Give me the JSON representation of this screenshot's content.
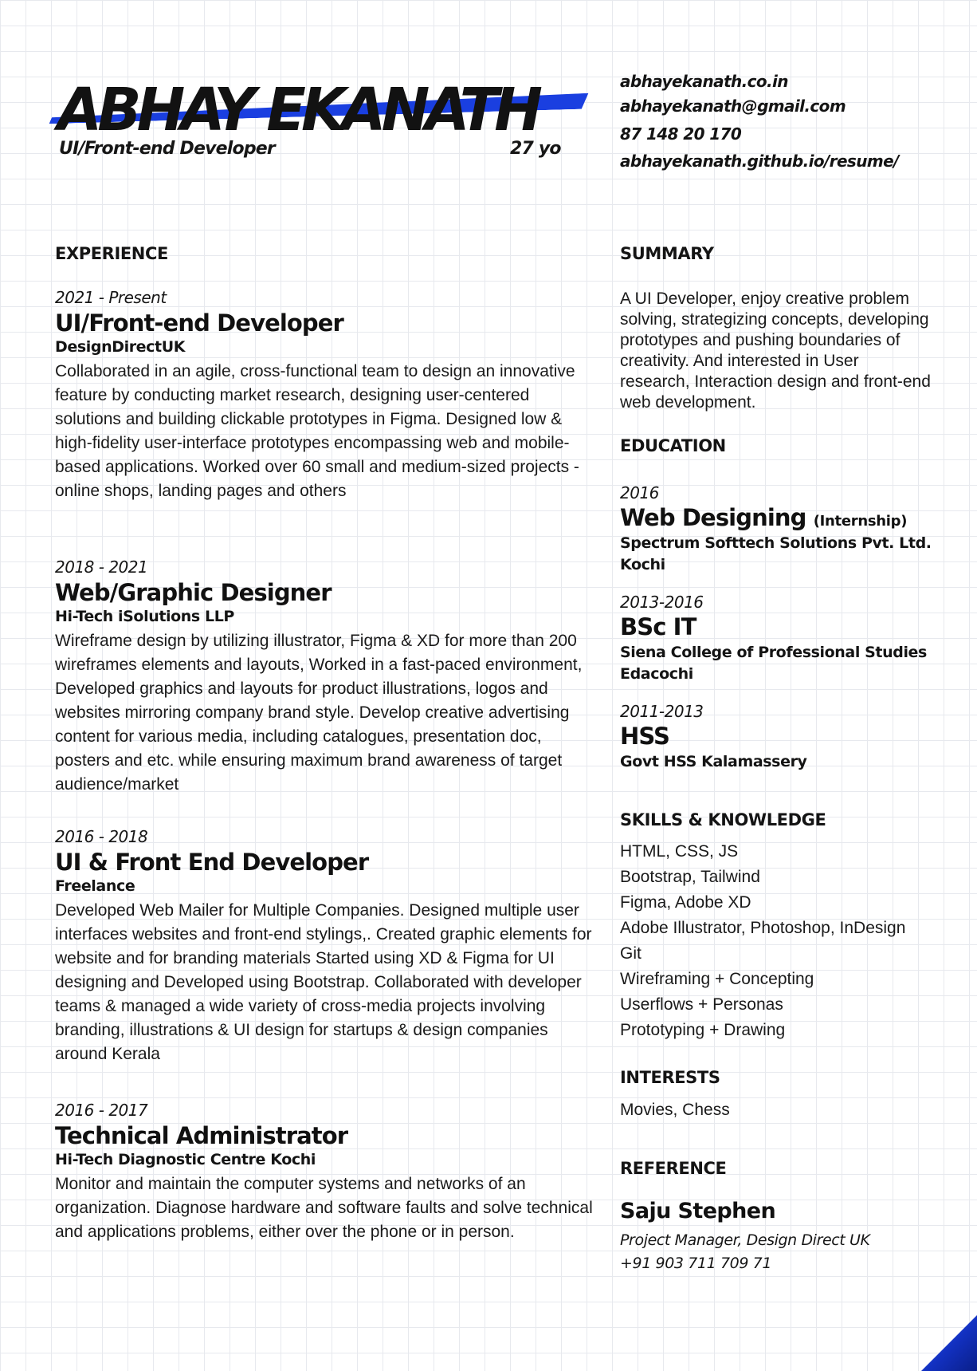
{
  "header": {
    "name": "ABHAY EKANATH",
    "role": "UI/Front-end Developer",
    "age": "27 yo",
    "accent_color": "#1a3fe0"
  },
  "contacts": {
    "website": "abhayekanath.co.in",
    "email": "abhayekanath@gmail.com",
    "phone": "87 148 20 170",
    "resume_url": "abhayekanath.github.io/resume/"
  },
  "experience": {
    "title": "EXPERIENCE",
    "items": [
      {
        "period": "2021 - Present",
        "title": "UI/Front-end Developer",
        "company": "DesignDirectUK",
        "desc": "Collaborated in an agile, cross-functional team to design an innovative feature by conducting market research, designing user-centered solutions and building clickable prototypes in Figma. Designed low & high-fidelity user-interface prototypes encompassing web and mobile-based applications. Worked over 60 small and medium-sized projects - online shops, landing pages and others"
      },
      {
        "period": "2018 - 2021",
        "title": "Web/Graphic Designer",
        "company": "Hi-Tech iSolutions LLP",
        "desc": "Wireframe design by utilizing illustrator, Figma & XD for more than 200 wireframes elements and layouts, Worked in a fast-paced environment, Developed graphics and layouts for product illustrations, logos and websites mirroring company brand style. Develop creative advertising content for various media, including catalogues, presentation doc, posters and etc. while ensuring maximum brand awareness of target audience/market"
      },
      {
        "period": "2016 - 2018",
        "title": "UI & Front End Developer",
        "company": "Freelance",
        "desc": "Developed Web Mailer for Multiple Companies. Designed multiple user interfaces websites and front-end stylings,. Created graphic elements for website and for branding materials Started using XD & Figma for UI designing and Developed using Bootstrap. Collaborated with developer teams & managed a wide variety of cross-media projects involving branding, illustrations & UI design for startups & design companies around Kerala"
      },
      {
        "period": "2016 - 2017",
        "title": "Technical Administrator",
        "company": "Hi-Tech Diagnostic Centre Kochi",
        "desc": "Monitor and maintain the computer systems and networks of an organization. Diagnose hardware and software faults and solve technical and applications problems, either over the phone or in person."
      }
    ]
  },
  "summary": {
    "title": "SUMMARY",
    "text": "A UI Developer, enjoy creative problem solving, strategizing concepts, developing prototypes and pushing boundaries of creativity. And interested in User research, Interaction design and front-end web development."
  },
  "education": {
    "title": "EDUCATION",
    "items": [
      {
        "period": "2016",
        "title": "Web Designing",
        "note": "(Internship)",
        "institution": "Spectrum Softtech Solutions Pvt. Ltd. Kochi"
      },
      {
        "period": "2013-2016",
        "title": "BSc IT",
        "note": "",
        "institution": "Siena College of Professional Studies Edacochi"
      },
      {
        "period": "2011-2013",
        "title": "HSS",
        "note": "",
        "institution": "Govt HSS Kalamassery"
      }
    ]
  },
  "skills": {
    "title": "SKILLS & KNOWLEDGE",
    "items": [
      "HTML, CSS, JS",
      "Bootstrap, Tailwind",
      "Figma, Adobe XD",
      "Adobe Illustrator, Photoshop, InDesign",
      "Git",
      "Wireframing + Concepting",
      "Userflows + Personas",
      "Prototyping + Drawing"
    ]
  },
  "interests": {
    "title": "INTERESTS",
    "text": "Movies, Chess"
  },
  "reference": {
    "title": "REFERENCE",
    "name": "Saju Stephen",
    "position": "Project Manager, Design Direct UK",
    "phone": "+91 903 711 709 71"
  }
}
